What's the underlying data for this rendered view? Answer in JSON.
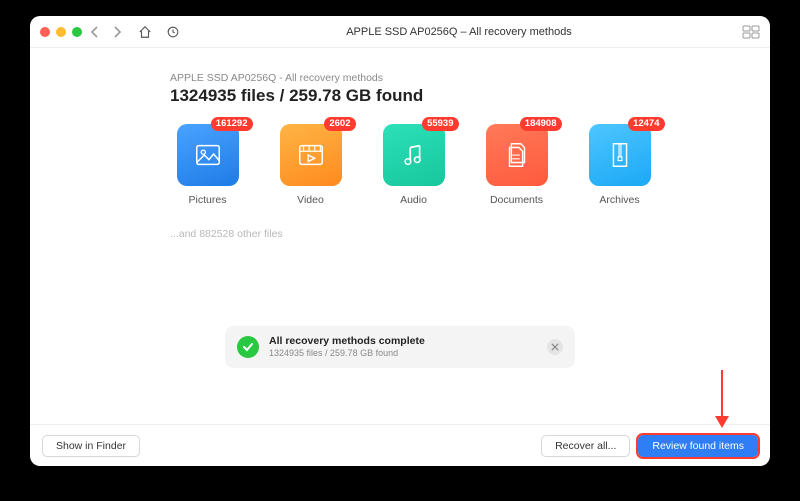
{
  "titlebar": {
    "title": "APPLE SSD AP0256Q – All recovery methods"
  },
  "header": {
    "scan_label": "APPLE SSD AP0256Q - All recovery methods",
    "headline": "1324935 files / 259.78 GB found"
  },
  "categories": [
    {
      "id": "pictures",
      "label": "Pictures",
      "count": "161292"
    },
    {
      "id": "video",
      "label": "Video",
      "count": "2602"
    },
    {
      "id": "audio",
      "label": "Audio",
      "count": "55939"
    },
    {
      "id": "documents",
      "label": "Documents",
      "count": "184908"
    },
    {
      "id": "archives",
      "label": "Archives",
      "count": "12474"
    }
  ],
  "other_files": "...and 882528 other files",
  "status": {
    "title": "All recovery methods complete",
    "sub": "1324935 files / 259.78 GB found"
  },
  "footer": {
    "show_in_finder": "Show in Finder",
    "recover_all": "Recover all...",
    "review": "Review found items"
  }
}
